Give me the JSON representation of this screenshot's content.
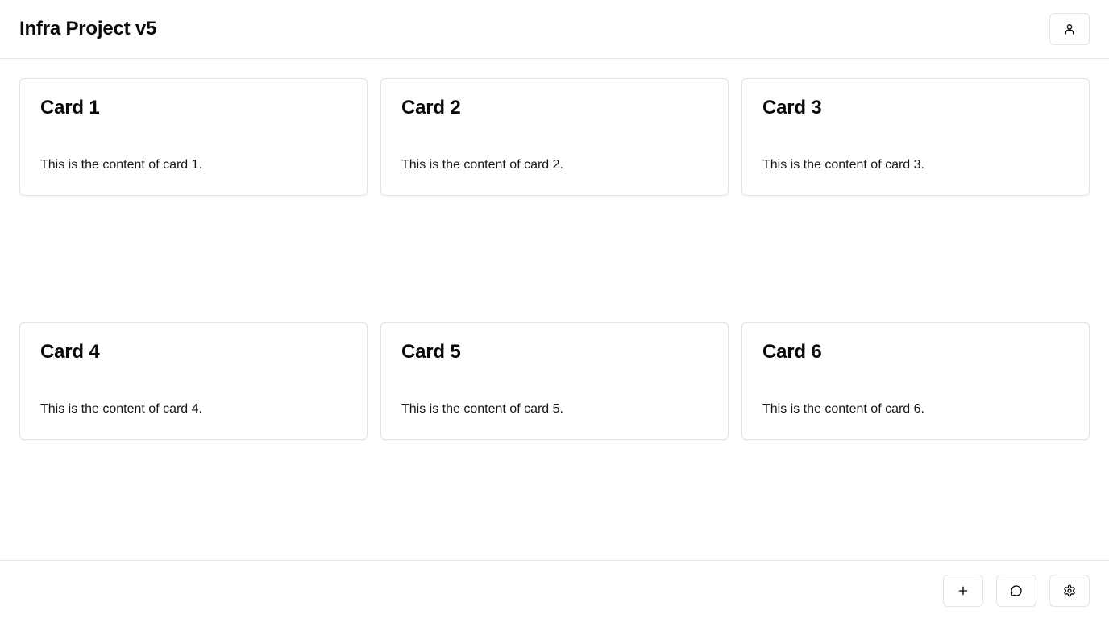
{
  "header": {
    "title": "Infra Project v5",
    "user_icon": "user-icon"
  },
  "cards": [
    {
      "title": "Card 1",
      "content": "This is the content of card 1."
    },
    {
      "title": "Card 2",
      "content": "This is the content of card 2."
    },
    {
      "title": "Card 3",
      "content": "This is the content of card 3."
    },
    {
      "title": "Card 4",
      "content": "This is the content of card 4."
    },
    {
      "title": "Card 5",
      "content": "This is the content of card 5."
    },
    {
      "title": "Card 6",
      "content": "This is the content of card 6."
    }
  ],
  "footer": {
    "actions": [
      {
        "icon": "plus-icon"
      },
      {
        "icon": "chat-bubble-icon"
      },
      {
        "icon": "gear-icon"
      }
    ]
  },
  "colors": {
    "border": "#e4e4e7",
    "text": "#09090b",
    "background": "#ffffff"
  }
}
